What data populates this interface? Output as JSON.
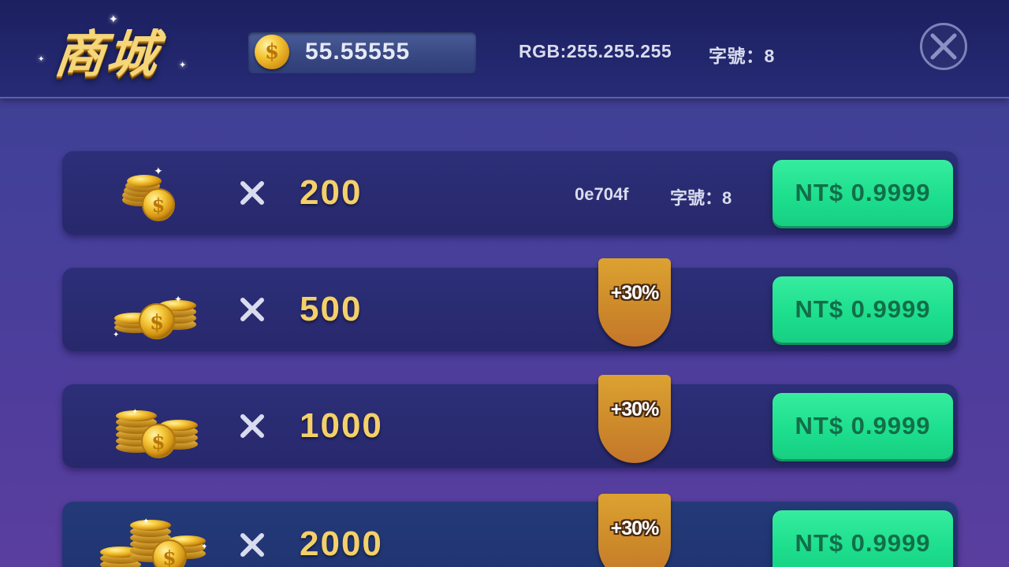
{
  "header": {
    "title": "商城",
    "balance": "55.55555",
    "rgb_text": "RGB:255.255.255",
    "font_size_text": "字號：8",
    "close_icon": "close-icon"
  },
  "colors": {
    "gold": "#f4d06a",
    "buy_green": "#1ddf8e",
    "bonus_orange": "#cd8a2a",
    "row_bg": "#2a2c72"
  },
  "packages": [
    {
      "amount": "200",
      "price": "NT$ 0.9999",
      "bonus": "",
      "info_color": "0e704f",
      "info_font": "字號：8",
      "times": "✕"
    },
    {
      "amount": "500",
      "price": "NT$ 0.9999",
      "bonus": "+30%",
      "times": "✕"
    },
    {
      "amount": "1000",
      "price": "NT$ 0.9999",
      "bonus": "+30%",
      "times": "✕"
    },
    {
      "amount": "2000",
      "price": "NT$ 0.9999",
      "bonus": "+30%",
      "times": "✕"
    }
  ]
}
